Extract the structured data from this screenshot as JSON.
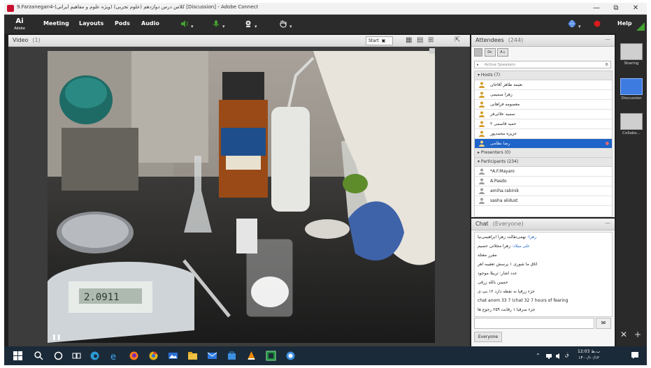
{
  "window": {
    "title": "9.Farzanegan4-(ویژه علوم و مفاهیم ایرانی) کلاس درس دوازدهم (علوم تجربی) [Discussion] - Adobe Connect",
    "minimize": "—",
    "maximize": "⧉",
    "close": "✕"
  },
  "menubar": {
    "logo": "Ai",
    "logo_sub": "Adobe",
    "items": [
      "Meeting",
      "Layouts",
      "Pods",
      "Audio"
    ],
    "help": "Help"
  },
  "video_pod": {
    "title": "Video",
    "count": "(1)",
    "start_label": "Start",
    "glyphs": [
      "▦",
      "▤",
      "⊞",
      "⇱"
    ]
  },
  "attendees": {
    "title": "Attendees",
    "count": "(244)",
    "search_placeholder": "Active Speakers",
    "hosts_label": "Hosts (7)",
    "hosts": [
      "نعیمه طاهر آقاجان",
      "زهرا صمیمی",
      "معصومه فراهانی",
      "سمیه علائی‌فر",
      "حمید قاسمی ۲",
      "عزیزه محمدپور",
      "رضا نظامی"
    ],
    "presenters_label": "Presenters (0)",
    "participants_label": "Participants (234)",
    "participants": [
      "*A.F.Mayani",
      "A.Pasdo",
      "amiha.rabinik",
      "sasha alidust"
    ]
  },
  "chat": {
    "title": "Chat",
    "scope": "(Everyone)",
    "lines": [
      {
        "name": "زهرا:",
        "text": "نهمی‌تقالت زهرا ابراهیمی‌نیا"
      },
      {
        "name": "علی میلاد:",
        "text": "زهرا مجلاتی حسیم"
      },
      {
        "name": "",
        "text": "مقرر معتلة"
      },
      {
        "name": "",
        "text": "اتاق ما شوری ۱ پرسش تعقیبه اهر"
      },
      {
        "name": "",
        "text": "عدد اشار: تربیلا موجود"
      },
      {
        "name": "",
        "text": "حسین بالله زرقی"
      },
      {
        "name": "",
        "text": "جزء زرقیا نه نقطه دارد ۱۲ بپ ی"
      },
      {
        "name": "",
        "text": "chat anom 33 7 (chat 32 7 hours of fearing"
      },
      {
        "name": "",
        "text": "جزء سرقیا ۱ رقابت ۲۵۹ رجوع ها"
      }
    ],
    "recipient": "Everyone",
    "send_icon": "💬"
  },
  "sidebar": {
    "items": [
      "Sharing",
      "Discussion",
      "Collabo..."
    ]
  },
  "taskbar": {
    "clock_time": "12:03 ب.ظ",
    "clock_date": "۱۴۰۰/۱۰/۱۲"
  },
  "colors": {
    "accent": "#1f64c8",
    "menubar": "#2b2b2b",
    "taskbar": "#1b2a38",
    "record_red": "#d81b1b",
    "mic_green": "#43a12f"
  }
}
